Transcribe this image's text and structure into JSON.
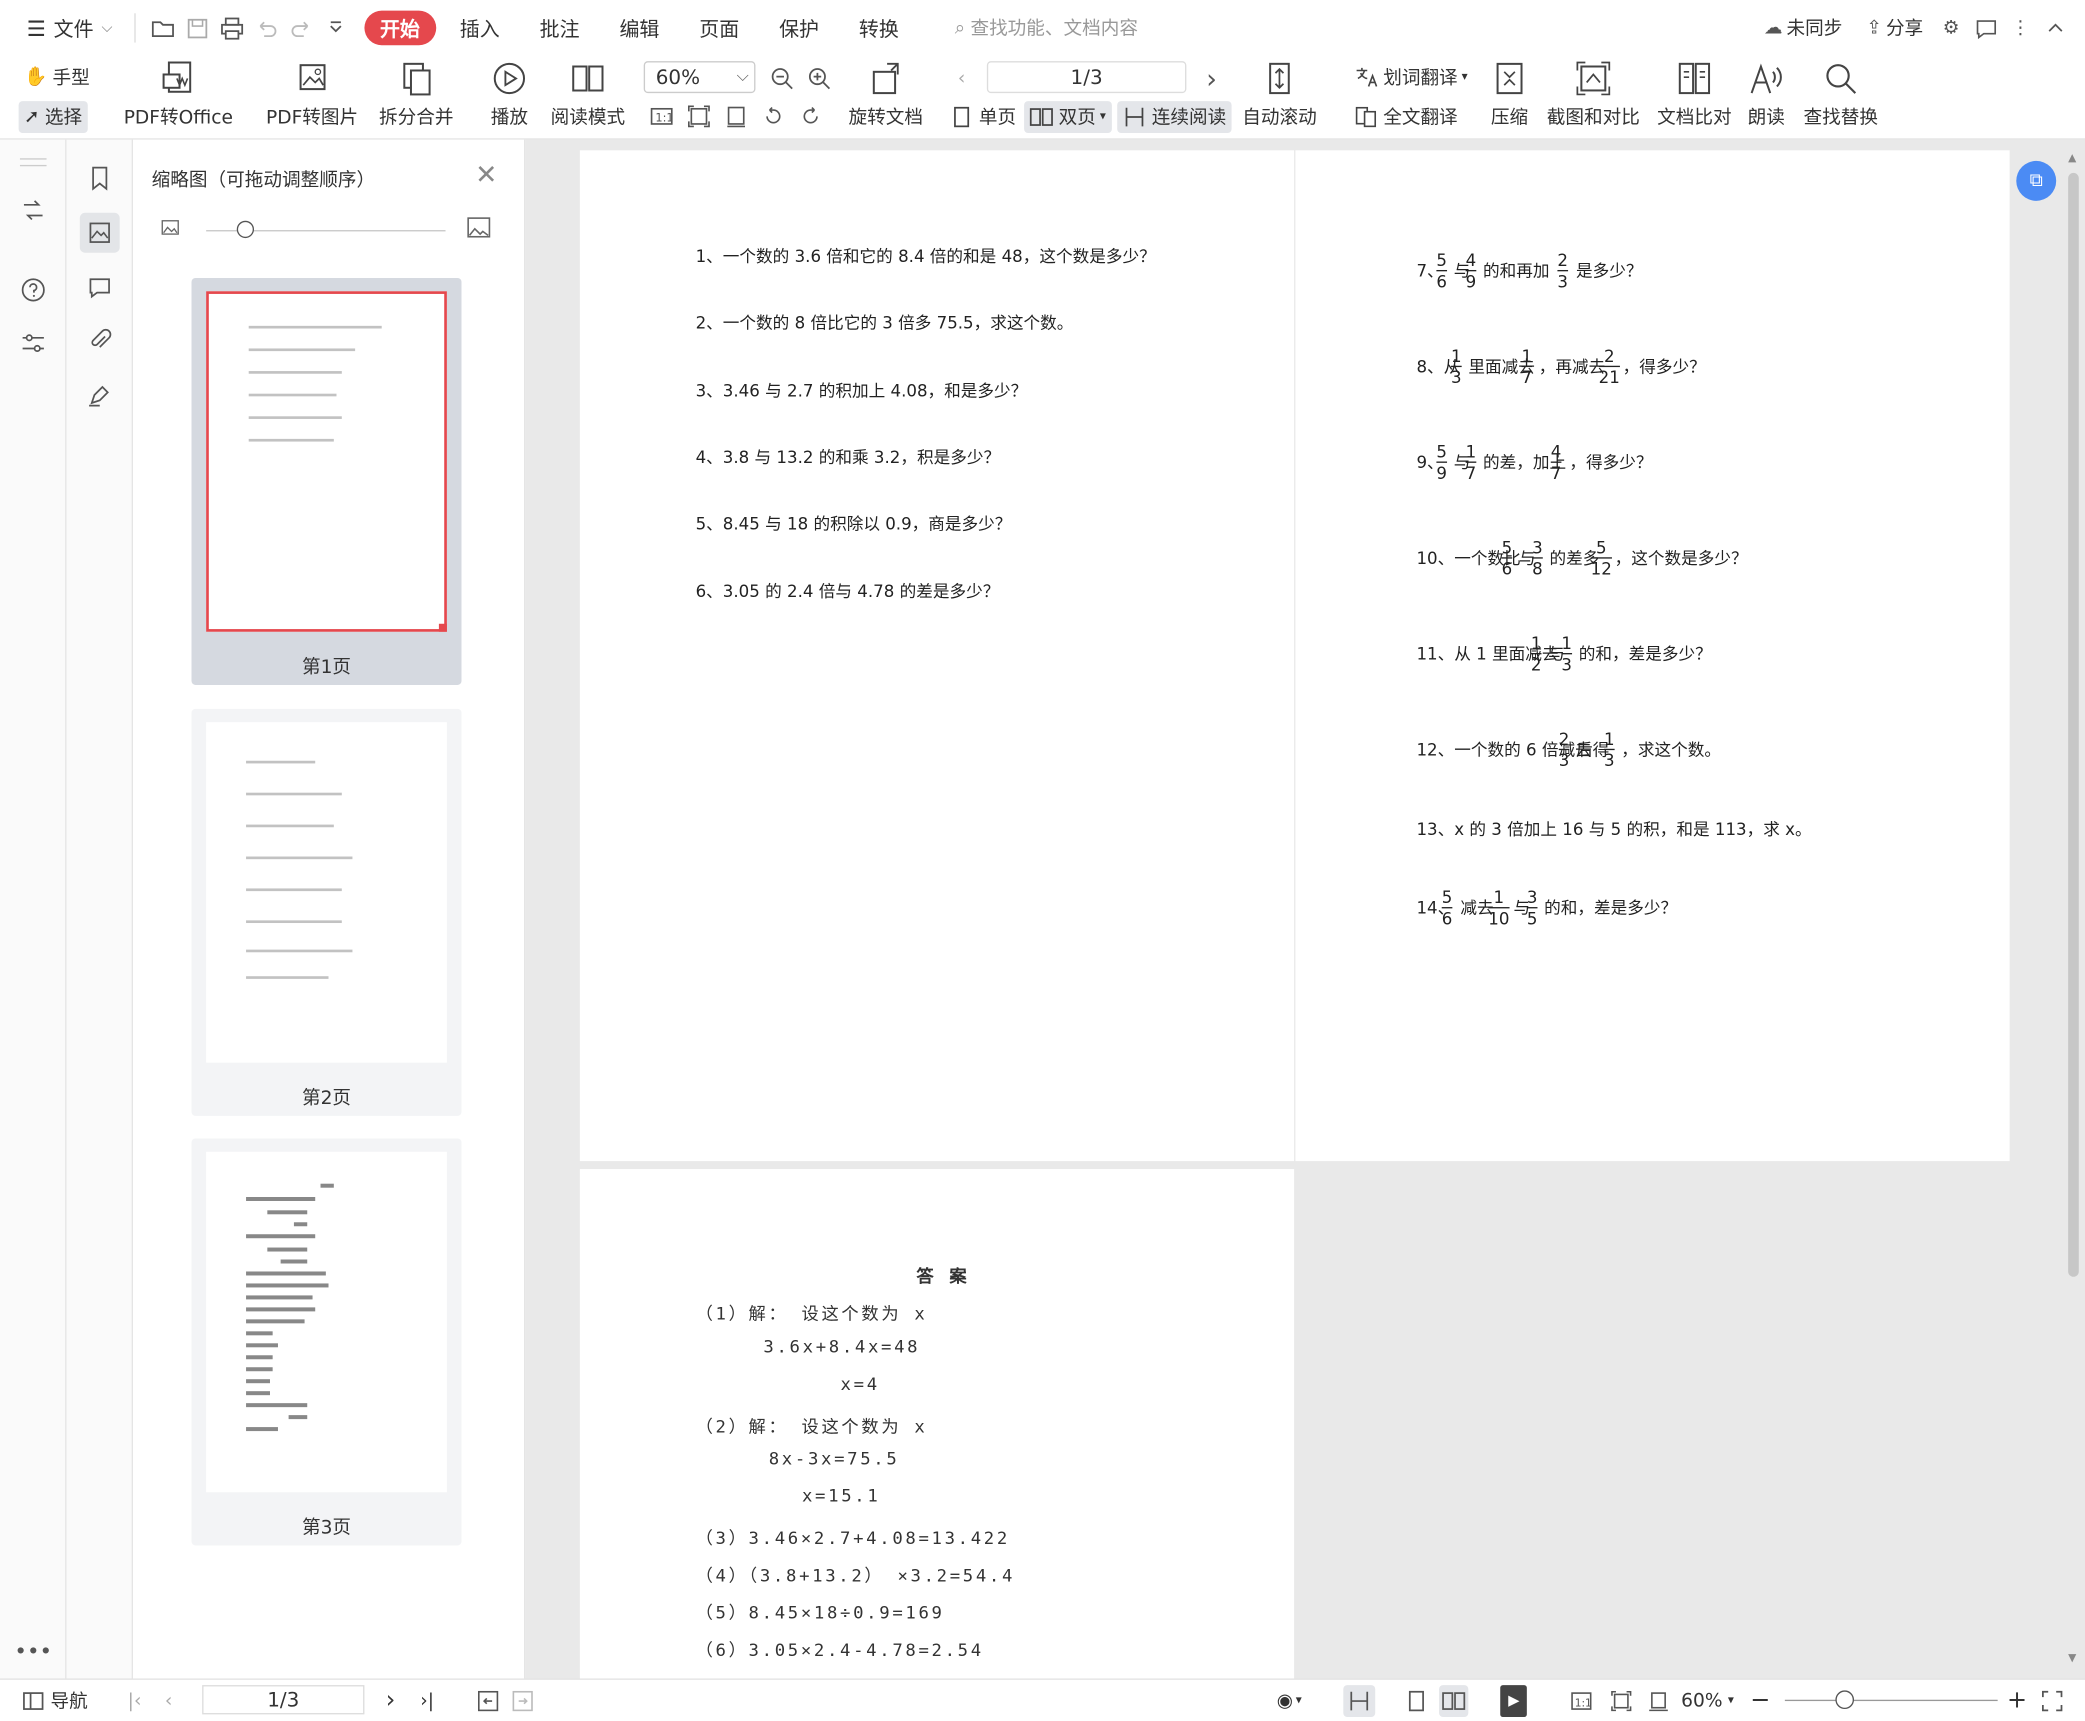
{
  "menubar": {
    "file_label": "文件",
    "tabs": [
      "开始",
      "插入",
      "批注",
      "编辑",
      "页面",
      "保护",
      "转换"
    ],
    "active_tab": "开始",
    "search_placeholder": "查找功能、文档内容",
    "sync_label": "未同步",
    "share_label": "分享"
  },
  "toolbar": {
    "hand_label": "手型",
    "select_label": "选择",
    "pdf_to_office": "PDF转Office",
    "pdf_to_image": "PDF转图片",
    "split_merge": "拆分合并",
    "play": "播放",
    "read_mode": "阅读模式",
    "zoom": "60%",
    "rotate": "旋转文档",
    "page_indicator": "1/3",
    "single_page": "单页",
    "double_page": "双页",
    "continuous": "连续阅读",
    "auto_scroll": "自动滚动",
    "word_translate": "划词翻译",
    "full_translate": "全文翻译",
    "compress": "压缩",
    "screenshot_compare": "截图和对比",
    "doc_compare": "文档比对",
    "read_aloud": "朗读",
    "find_replace": "查找替换"
  },
  "thumbnails": {
    "title": "缩略图（可拖动调整顺序）",
    "pages": [
      "第1页",
      "第2页",
      "第3页"
    ]
  },
  "doc": {
    "page1": [
      "1、一个数的 3.6 倍和它的 8.4 倍的和是 48，这个数是多少？",
      "2、一个数的 8 倍比它的 3 倍多 75.5，求这个数。",
      "3、3.46 与 2.7 的积加上 4.08，和是多少？",
      "4、3.8 与 13.2 的和乘 3.2，积是多少？",
      "5、8.45 与 18 的积除以 0.9，商是多少？",
      "6、3.05 的 2.4 倍与 4.78 的差是多少？"
    ],
    "page2": {
      "q7": {
        "pre": "7、",
        "t1": "与",
        "t2": "的和再加",
        "t3": "是多少？",
        "f": [
          [
            "5",
            "6"
          ],
          [
            "4",
            "9"
          ],
          [
            "2",
            "3"
          ]
        ]
      },
      "q8": {
        "pre": "8、从",
        "t1": "里面减去",
        "t2": "，再减去",
        "t3": "，得多少？",
        "f": [
          [
            "1",
            "3"
          ],
          [
            "1",
            "7"
          ],
          [
            "2",
            "21"
          ]
        ]
      },
      "q9": {
        "pre": "9、",
        "t1": "与",
        "t2": "的差，加上",
        "t3": "，得多少？",
        "f": [
          [
            "5",
            "9"
          ],
          [
            "1",
            "7"
          ],
          [
            "4",
            "7"
          ]
        ]
      },
      "q10": {
        "pre": "10、一个数比",
        "t1": "与",
        "t2": "的差多",
        "t3": "，这个数是多少？",
        "f": [
          [
            "5",
            "6"
          ],
          [
            "3",
            "8"
          ],
          [
            "5",
            "12"
          ]
        ]
      },
      "q11": {
        "pre": "11、从 1 里面减去",
        "t1": "与",
        "t2": "的和，差是多少？",
        "f": [
          [
            "1",
            "2"
          ],
          [
            "1",
            "3"
          ]
        ]
      },
      "q12": {
        "pre": "12、一个数的 6 倍减去",
        "t1": "后得",
        "t2": "，求这个数。",
        "f": [
          [
            "2",
            "3"
          ],
          [
            "1",
            "3"
          ]
        ]
      },
      "q13": "13、x 的 3 倍加上 16 与 5 的积，和是 113，求 x。",
      "q14": {
        "pre": "14、",
        "t1": "减去",
        "t2": "与",
        "t3": "的和，差是多少？",
        "f": [
          [
            "5",
            "6"
          ],
          [
            "1",
            "10"
          ],
          [
            "3",
            "5"
          ]
        ]
      }
    },
    "page3": {
      "title": "答 案",
      "lines": [
        "（1）解： 设这个数为 x",
        "3.6x+8.4x=48",
        "x=4",
        "（2）解： 设这个数为 x",
        "8x-3x=75.5",
        "x=15.1",
        "（3）3.46×2.7+4.08=13.422",
        "（4）（3.8+13.2） ×3.2=54.4",
        "（5）8.45×18÷0.9=169",
        "（6）3.05×2.4-4.78=2.54"
      ]
    }
  },
  "statusbar": {
    "nav_label": "导航",
    "page": "1/3",
    "zoom": "60%"
  },
  "colors": {
    "accent": "#e5484d",
    "float_button": "#4b8bf4"
  }
}
